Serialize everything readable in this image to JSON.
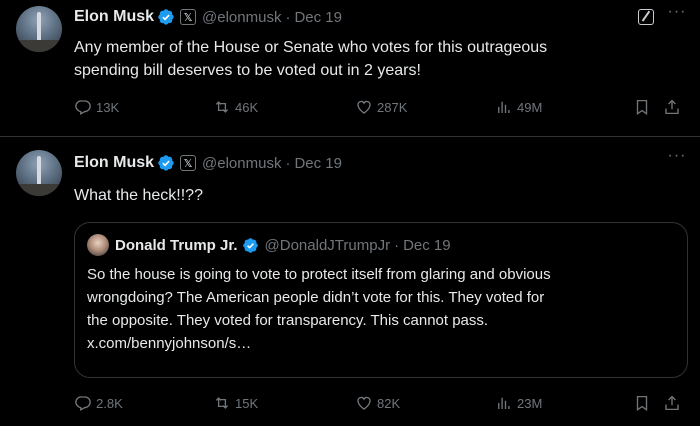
{
  "tweets": [
    {
      "author": {
        "name": "Elon Musk",
        "handle": "@elonmusk",
        "date": "Dec 19"
      },
      "text_lines": [
        "Any member of the House or Senate who votes for this outrageous",
        "spending bill deserves to be voted out in 2 years!"
      ],
      "stats": {
        "replies": "13K",
        "reposts": "46K",
        "likes": "287K",
        "views": "49M"
      }
    },
    {
      "author": {
        "name": "Elon Musk",
        "handle": "@elonmusk",
        "date": "Dec 19"
      },
      "text_lines": [
        "What the heck!!??"
      ],
      "quote": {
        "author": {
          "name": "Donald Trump Jr.",
          "handle": "@DonaldJTrumpJr",
          "date": "Dec 19"
        },
        "text_lines": [
          "So the house is going to vote to protect itself from glaring and obvious",
          "wrongdoing? The American people didn’t vote for this. They voted for",
          "the opposite. They voted for transparency. This cannot pass.",
          "x.com/bennyjohnson/s…"
        ]
      },
      "stats": {
        "replies": "2.8K",
        "reposts": "15K",
        "likes": "82K",
        "views": "23M"
      }
    }
  ],
  "ui": {
    "separator_dot": "·",
    "affiliate_badge": "𝕏",
    "more_dots": "···"
  },
  "colors": {
    "verified": "#1d9bf0",
    "muted": "#71767b",
    "text": "#e7e9ea",
    "border": "#2f3336"
  },
  "icons": [
    "reply-icon",
    "repost-icon",
    "like-icon",
    "views-icon",
    "bookmark-icon",
    "share-icon",
    "verified-badge-icon",
    "grok-icon",
    "more-icon"
  ]
}
